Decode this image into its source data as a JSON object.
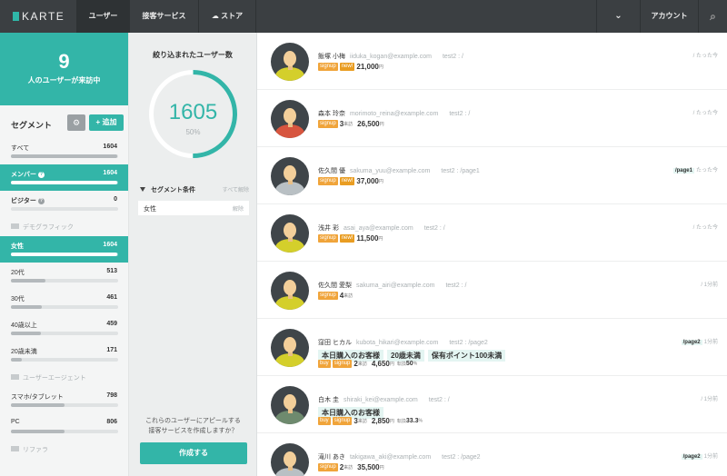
{
  "topbar": {
    "logo": "KARTE",
    "nav_users": "ユーザー",
    "nav_service": "接客サービス",
    "nav_store": "ストア",
    "nav_account": "アカウント",
    "nav_dropdown": "▾",
    "search": "⌕"
  },
  "sidebar": {
    "visitor_count": "9",
    "visitor_label": "人のユーザーが来訪中",
    "segment_title": "セグメント",
    "add_label": "+ 追加",
    "categories": {
      "demographic": "デモグラフィック",
      "agent": "ユーザーエージェント",
      "referrer": "リファラ"
    },
    "items": [
      {
        "label": "すべて",
        "count": "1604",
        "fill": 0.99
      },
      {
        "label": "メンバー",
        "count": "1604",
        "fill": 0.99
      },
      {
        "label": "ビジター",
        "count": "0",
        "fill": 0
      },
      {
        "label": "女性",
        "count": "1604",
        "fill": 0.99
      },
      {
        "label": "20代",
        "count": "513",
        "fill": 0.32
      },
      {
        "label": "30代",
        "count": "461",
        "fill": 0.29
      },
      {
        "label": "40歳以上",
        "count": "459",
        "fill": 0.28
      },
      {
        "label": "20歳未満",
        "count": "171",
        "fill": 0.1
      },
      {
        "label": "スマホ/タブレット",
        "count": "798",
        "fill": 0.5
      },
      {
        "label": "PC",
        "count": "806",
        "fill": 0.5
      }
    ]
  },
  "middle": {
    "title": "絞り込まれたユーザー数",
    "count": "1605",
    "percent": "50%",
    "percent_value": 50,
    "conditions_title": "セグメント条件",
    "clear_all": "すべて解除",
    "condition": "女性",
    "condition_remove": "解除",
    "appeal_line1": "これらのユーザーにアピールする",
    "appeal_line2": "接客サービスを作成しますか？",
    "create_button": "作成する"
  },
  "users": [
    {
      "name": "飯塚 小梅",
      "email": "iiduka_kogan@example.com",
      "path": "test2 : /",
      "time": "/ たった今",
      "page_tag": "",
      "badges": [
        "signup",
        "new!"
      ],
      "visits": "",
      "amount": "21,000",
      "cv": "",
      "tags": [],
      "shirt": "#d4cf2b"
    },
    {
      "name": "森本 玲奈",
      "email": "morimoto_reina@example.com",
      "path": "test2 : /",
      "time": "/ たった今",
      "page_tag": "",
      "badges": [
        "signup"
      ],
      "visits": "3",
      "amount": "26,500",
      "cv": "",
      "tags": [],
      "shirt": "#d7553f"
    },
    {
      "name": "佐久間 優",
      "email": "sakuma_yuu@example.com",
      "path": "test2 : /page1",
      "time": "たった今",
      "page_tag": "/page1",
      "badges": [
        "signup",
        "new!"
      ],
      "visits": "",
      "amount": "37,000",
      "cv": "",
      "tags": [],
      "shirt": "#b9c0c4"
    },
    {
      "name": "浅井 彩",
      "email": "asai_aya@example.com",
      "path": "test2 : /",
      "time": "/ たった今",
      "page_tag": "",
      "badges": [
        "signup",
        "new!"
      ],
      "visits": "",
      "amount": "11,500",
      "cv": "",
      "tags": [],
      "shirt": "#d4cf2b"
    },
    {
      "name": "佐久間 愛梨",
      "email": "sakuma_airi@example.com",
      "path": "test2 : /",
      "time": "/ 1分前",
      "page_tag": "",
      "badges": [
        "signup"
      ],
      "visits": "4",
      "amount": "",
      "cv": "",
      "tags": [],
      "shirt": "#d4cf2b"
    },
    {
      "name": "窪田 ヒカル",
      "email": "kubota_hikari@example.com",
      "path": "test2 : /page2",
      "time": "1分前",
      "page_tag": "/page2",
      "badges": [
        "buy",
        "signup"
      ],
      "visits": "2",
      "amount": "4,650",
      "cv": "50",
      "tags": [
        "本日購入のお客様",
        "20歳未満",
        "保有ポイント100未満"
      ],
      "shirt": "#d4cf2b"
    },
    {
      "name": "白木 圭",
      "email": "shiraki_kei@example.com",
      "path": "test2 : /",
      "time": "/ 1分前",
      "page_tag": "",
      "badges": [
        "buy",
        "signup"
      ],
      "visits": "3",
      "amount": "2,850",
      "cv": "33.3",
      "tags": [
        "本日購入のお客様"
      ],
      "shirt": "#6e8a6e"
    },
    {
      "name": "滝川 あき",
      "email": "takigawa_aki@example.com",
      "path": "test2 : /page2",
      "time": "1分前",
      "page_tag": "/page2",
      "badges": [
        "signup"
      ],
      "visits": "2",
      "amount": "35,500",
      "cv": "",
      "tags": [],
      "shirt": "#b9c0c4"
    }
  ],
  "labels": {
    "visits_unit": "来訪",
    "yen_unit": "円",
    "cv_label": "転換",
    "cv_unit": "%"
  },
  "colors": {
    "accent": "#33b5a8",
    "topbar": "#3b3f42",
    "badge": "#f0a43a"
  }
}
